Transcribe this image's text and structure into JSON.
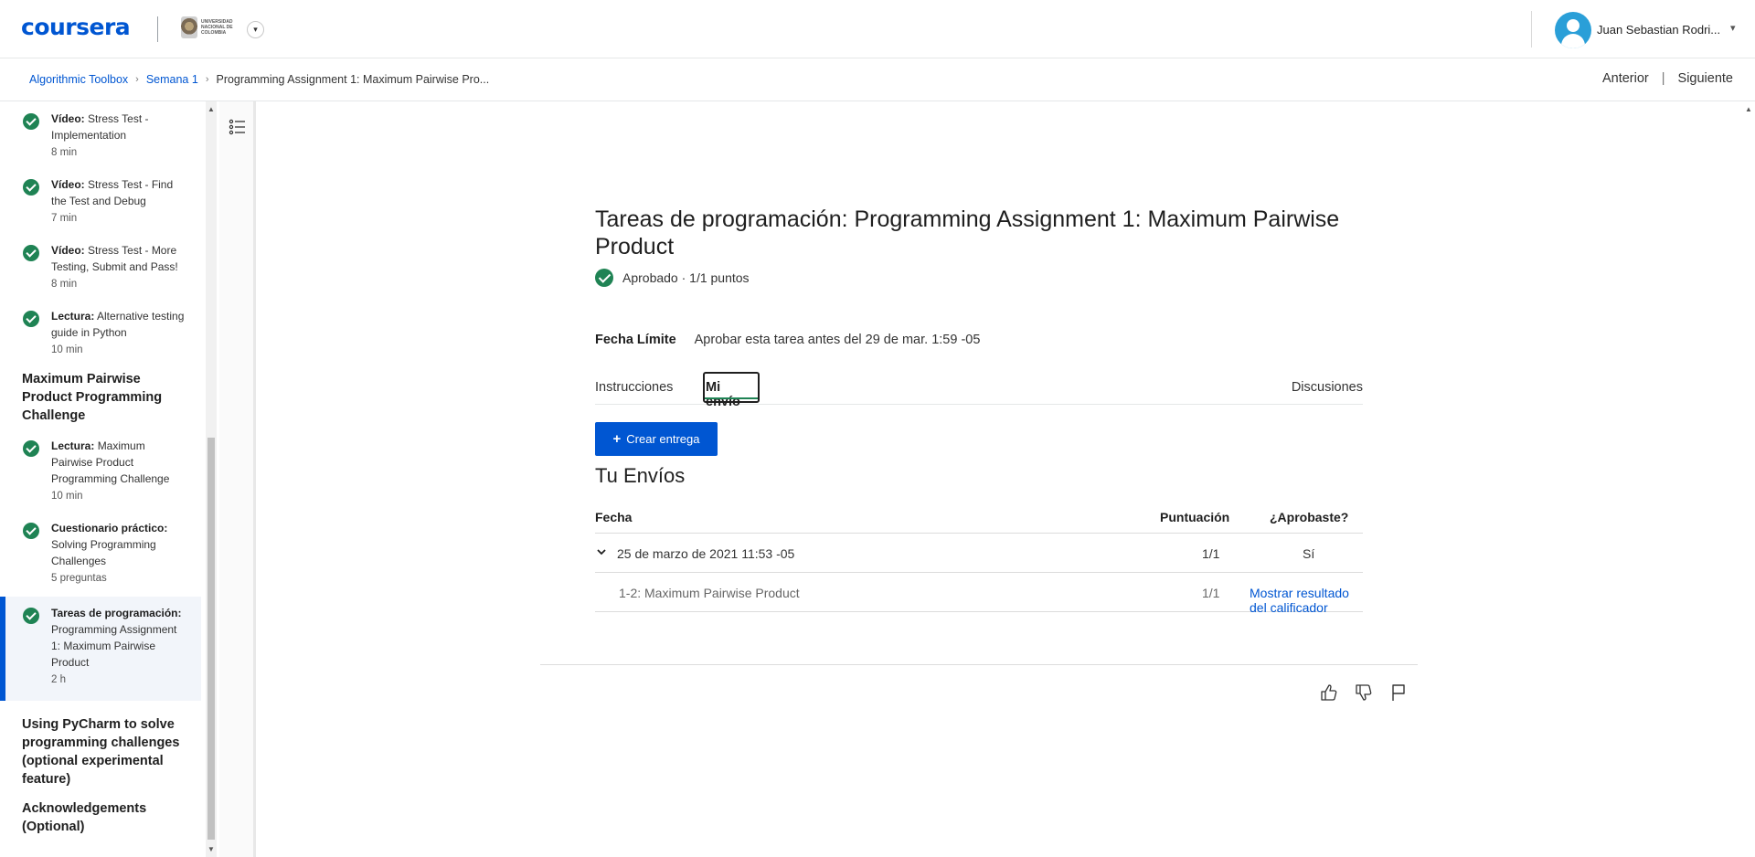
{
  "header": {
    "logo": "coursera",
    "university_name": "UNIVERSIDAD NACIONAL DE COLOMBIA",
    "user_name": "Juan Sebastian Rodri..."
  },
  "breadcrumb": {
    "items": [
      "Algorithmic Toolbox",
      "Semana 1"
    ],
    "current": "Programming Assignment 1: Maximum Pairwise Pro..."
  },
  "nav": {
    "prev": "Anterior",
    "separator": "|",
    "next": "Siguiente"
  },
  "sidebar": {
    "items": [
      {
        "type": "Vídeo:",
        "title": "Stress Test - Implementation",
        "meta": "8 min"
      },
      {
        "type": "Vídeo:",
        "title": "Stress Test - Find the Test and Debug",
        "meta": "7 min"
      },
      {
        "type": "Vídeo:",
        "title": "Stress Test - More Testing, Submit and Pass!",
        "meta": "8 min"
      },
      {
        "type": "Lectura:",
        "title": "Alternative testing guide in Python",
        "meta": "10 min"
      }
    ],
    "section1": "Maximum Pairwise Product Programming Challenge",
    "items2": [
      {
        "type": "Lectura:",
        "title": "Maximum Pairwise Product Programming Challenge",
        "meta": "10 min"
      },
      {
        "type": "Cuestionario práctico:",
        "title": "Solving Programming Challenges",
        "meta": "5 preguntas"
      },
      {
        "type": "Tareas de programación:",
        "title": "Programming Assignment 1: Maximum Pairwise Product",
        "meta": "2 h"
      }
    ],
    "section2": "Using PyCharm to solve programming challenges (optional experimental feature)",
    "section3": "Acknowledgements (Optional)"
  },
  "main": {
    "title": "Tareas de programación: Programming Assignment 1: Maximum Pairwise Product",
    "status": "Aprobado · 1/1 puntos",
    "deadline_label": "Fecha Límite",
    "deadline_text": "Aprobar esta tarea antes del 29 de mar. 1:59 -05",
    "tabs": {
      "instructions": "Instrucciones",
      "my_submission": "Mi envío",
      "discussions": "Discusiones"
    },
    "create_button": "Crear entrega",
    "submissions_title": "Tu Envíos",
    "table": {
      "headers": {
        "date": "Fecha",
        "score": "Puntuación",
        "passed": "¿Aprobaste?"
      },
      "row": {
        "date": "25 de marzo de 2021 11:53 -05",
        "score": "1/1",
        "passed": "Sí"
      },
      "subrow": {
        "name": "1-2: Maximum Pairwise Product",
        "score": "1/1",
        "link": "Mostrar resultado del calificador"
      }
    }
  },
  "colors": {
    "brand": "#0056d2",
    "success": "#1f8354"
  }
}
